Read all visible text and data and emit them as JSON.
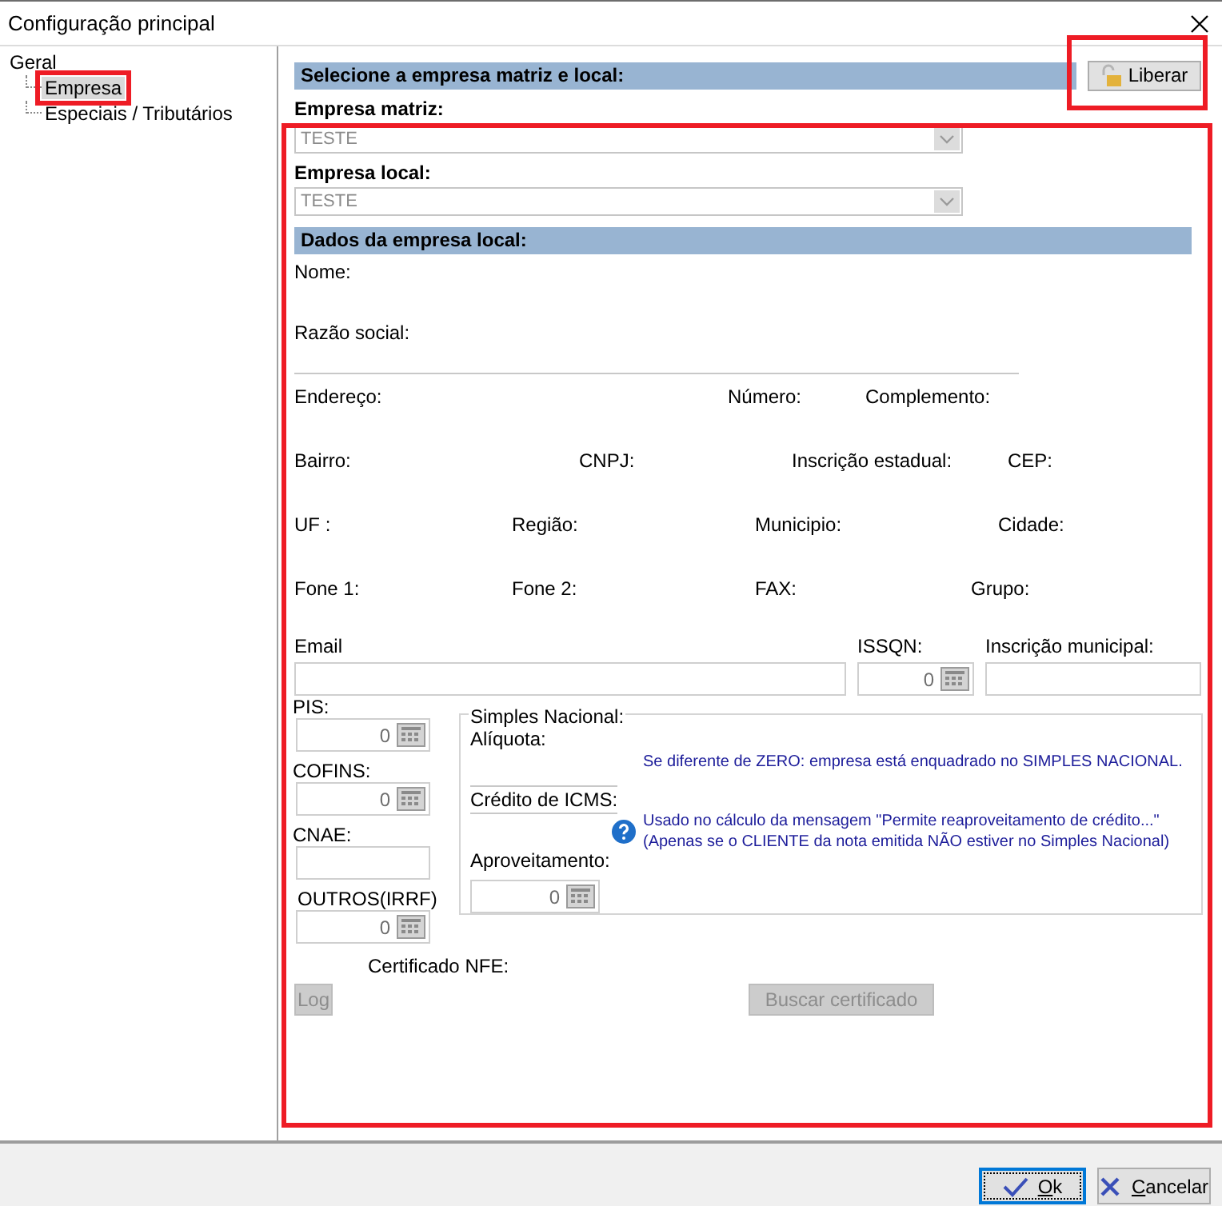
{
  "window": {
    "title": "Configuração principal"
  },
  "tree": [
    {
      "label": "Geral",
      "selected": false,
      "children": [
        {
          "label": "Empresa",
          "selected": true,
          "highlighted": true
        },
        {
          "label": "Especiais / Tributários",
          "selected": false,
          "highlighted": false
        }
      ]
    }
  ],
  "selection": {
    "title": "Selecione a empresa matriz e local:",
    "highlighted": true,
    "unlock_button": {
      "label": "Liberar",
      "highlighted": true
    },
    "fields": [
      {
        "label": "Empresa matriz:",
        "value": "TESTE",
        "disabled": true
      },
      {
        "label": "Empresa local:",
        "value": "TESTE",
        "disabled": true
      }
    ]
  },
  "details": {
    "title": "Dados da empresa local:",
    "name_label": "Nome:",
    "razao_label": "Razão social:",
    "address_line": [
      "Endereço:",
      "Número:",
      "Complemento:"
    ],
    "registry_line": [
      "Bairro:",
      "CNPJ:",
      "Inscrição estadual:",
      "CEP:"
    ],
    "region_line": [
      "UF :",
      "Região:",
      "Municipio:",
      "Cidade:"
    ],
    "phone_line": [
      "Fone 1:",
      "Fone 2:",
      "FAX:",
      "Grupo:"
    ],
    "inputs": [
      {
        "label": "Email",
        "kind": "text"
      },
      {
        "label": "ISSQN:",
        "kind": "number",
        "value": "0"
      },
      {
        "label": "Inscrição municipal:",
        "kind": "text"
      }
    ]
  },
  "taxes": [
    {
      "label": "PIS:",
      "input": {
        "kind": "number",
        "value": "0"
      }
    },
    {
      "label": "COFINS:",
      "input": {
        "kind": "number",
        "value": "0"
      }
    },
    {
      "label": "CNAE:",
      "input": {
        "kind": "text"
      }
    },
    {
      "label": "OUTROS(IRRF)",
      "input": {
        "kind": "number",
        "value": "0"
      }
    }
  ],
  "simples": {
    "title": "Simples Nacional:",
    "aliquota_label": "Alíquota:",
    "credit_label": "Crédito de ICMS:",
    "aproveitamento": {
      "label": "Aproveitamento:",
      "value": "0"
    },
    "note_zero": "Se diferente de ZERO: empresa está enquadrado no SIMPLES NACIONAL.",
    "note_credit": [
      "Usado no cálculo da mensagem \"Permite reaproveitamento de crédito...\"",
      "(Apenas se o CLIENTE da nota emitida NÃO estiver no Simples Nacional)"
    ]
  },
  "certificate": {
    "label": "Certificado NFE:",
    "log_button": {
      "label": "Log",
      "disabled": true
    },
    "search_button": {
      "label": "Buscar certificado",
      "disabled": true
    }
  },
  "buttons": [
    {
      "label": "Ok",
      "kind": "ok",
      "focused": true
    },
    {
      "label": "Cancelar",
      "kind": "cancel",
      "focused": false
    }
  ]
}
